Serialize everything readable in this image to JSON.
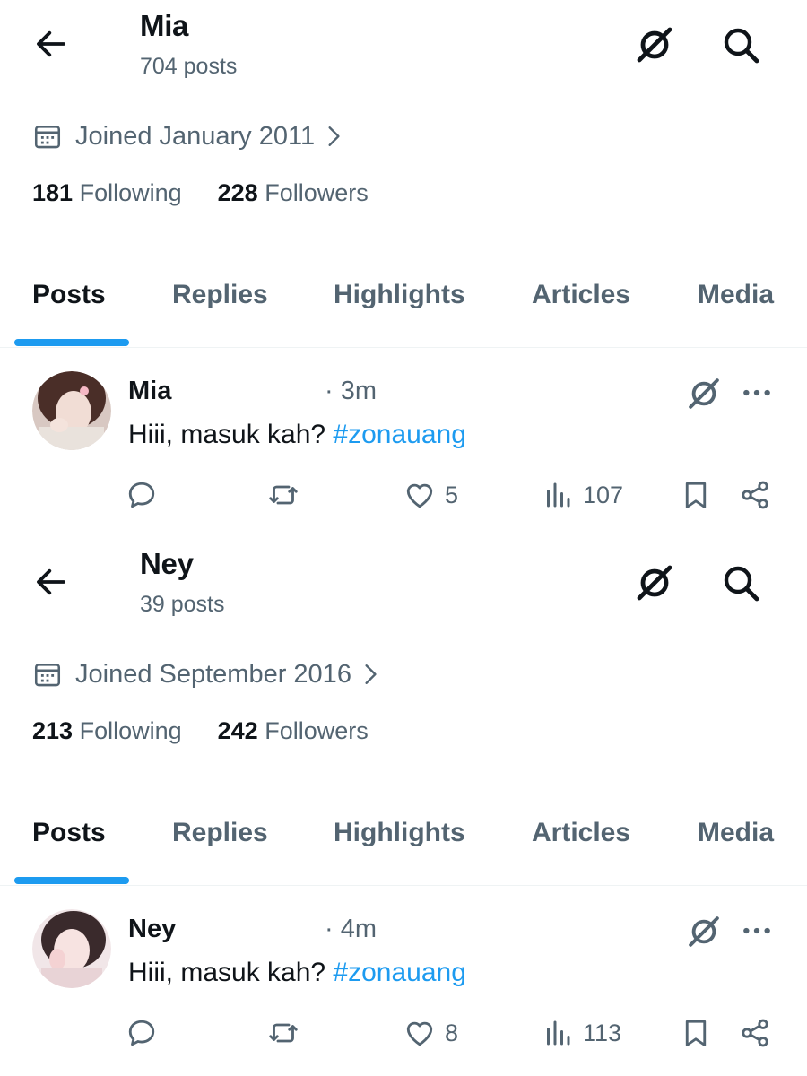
{
  "colors": {
    "text": "#0f1419",
    "secondary": "#536471",
    "accent": "#1d9bf0",
    "border": "#eff3f4"
  },
  "icons": {
    "back": "arrow-left-icon",
    "grok": "grok-icon",
    "search": "search-icon",
    "calendar": "calendar-icon",
    "chevron": "chevron-right-icon",
    "more": "more-dots-icon",
    "reply": "reply-icon",
    "repost": "repost-icon",
    "like": "heart-icon",
    "views": "views-icon",
    "bookmark": "bookmark-icon",
    "share": "share-icon"
  },
  "profiles": [
    {
      "header": {
        "name": "Mia",
        "post_count": "704 posts"
      },
      "joined": "Joined January 2011",
      "following_count": "181",
      "following_label": "Following",
      "followers_count": "228",
      "followers_label": "Followers",
      "tabs": [
        "Posts",
        "Replies",
        "Highlights",
        "Articles",
        "Media"
      ],
      "active_tab": "Posts",
      "post": {
        "author": "Mia",
        "time": "· 3m",
        "text": "Hiii, masuk kah?",
        "hashtag": "#zonauang",
        "likes": "5",
        "views": "107"
      }
    },
    {
      "header": {
        "name": "Ney",
        "post_count": "39 posts"
      },
      "joined": "Joined September 2016",
      "following_count": "213",
      "following_label": "Following",
      "followers_count": "242",
      "followers_label": "Followers",
      "tabs": [
        "Posts",
        "Replies",
        "Highlights",
        "Articles",
        "Media"
      ],
      "active_tab": "Posts",
      "post": {
        "author": "Ney",
        "time": "· 4m",
        "text": "Hiii, masuk kah?",
        "hashtag": "#zonauang",
        "likes": "8",
        "views": "113"
      }
    }
  ]
}
